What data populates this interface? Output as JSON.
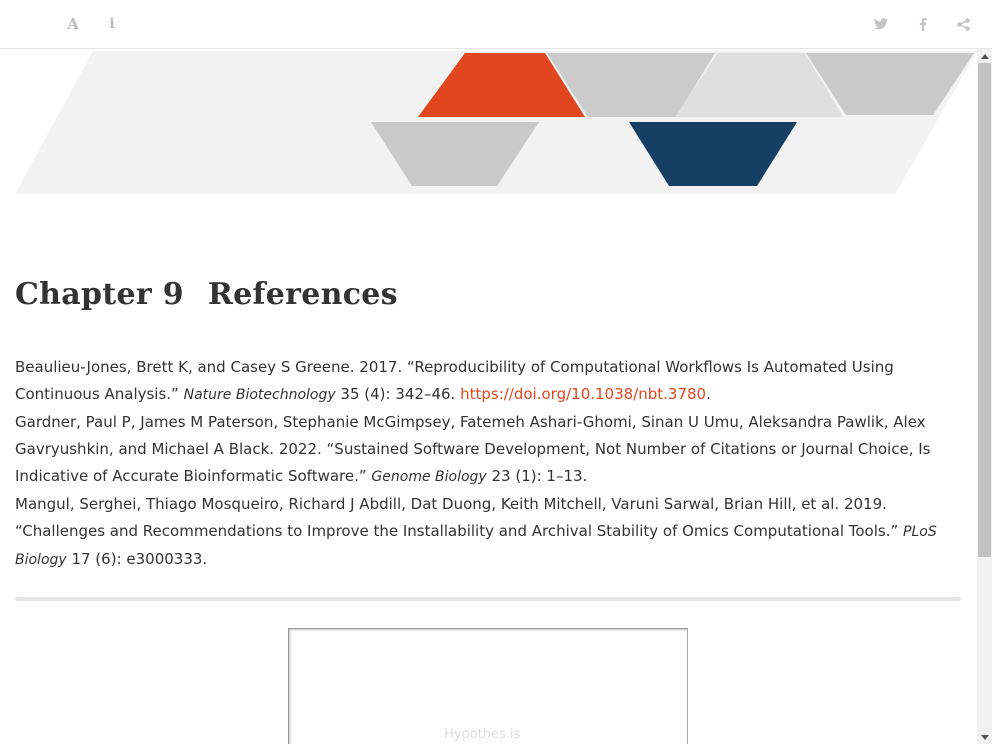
{
  "toolbar": {
    "left_buttons": [
      {
        "icon": "font-icon",
        "glyph": "A"
      },
      {
        "icon": "info-icon",
        "glyph": "i"
      }
    ],
    "right_buttons": [
      {
        "icon": "twitter-icon"
      },
      {
        "icon": "facebook-icon"
      },
      {
        "icon": "share-icon"
      }
    ]
  },
  "banner": {
    "colors": {
      "orange": "#e2461f",
      "navy": "#173f63",
      "gray": "#c9c9c9",
      "light": "#f2f2f2"
    }
  },
  "chapter": {
    "number": "Chapter 9",
    "title": "References"
  },
  "references": [
    {
      "text": "Beaulieu-Jones, Brett K, and Casey S Greene. 2017. “Reproducibility of Computational Workflows Is Automated Using Continuous Analysis.” ",
      "journal": "Nature Biotechnology",
      "details": " 35 (4): 342–46. ",
      "link": "https://doi.org/10.1038/nbt.3780",
      "after": "."
    },
    {
      "text": "Gardner, Paul P, James M Paterson, Stephanie McGimpsey, Fatemeh Ashari-Ghomi, Sinan U Umu, Aleksandra Pawlik, Alex Gavryushkin, and Michael A Black. 2022. “Sustained Software Development, Not Number of Citations or Journal Choice, Is Indicative of Accurate Bioinformatic Software.” ",
      "journal": "Genome Biology",
      "details": " 23 (1): 1–13.",
      "link": "",
      "after": ""
    },
    {
      "text": "Mangul, Serghei, Thiago Mosqueiro, Richard J Abdill, Dat Duong, Keith Mitchell, Varuni Sarwal, Brian Hill, et al. 2019. “Challenges and Recommendations to Improve the Installability and Archival Stability of Omics Computational Tools.” ",
      "journal": "PLoS Biology",
      "details": " 17 (6): e3000333.",
      "link": "",
      "after": ""
    }
  ],
  "embed": {
    "label": "Hypothes.is"
  }
}
